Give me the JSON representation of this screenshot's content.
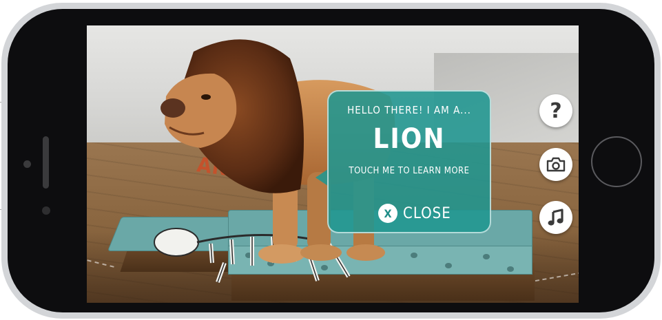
{
  "bubble": {
    "greeting": "HELLO THERE! I AM A...",
    "animal_name": "LION",
    "hint": "TOUCH ME TO LEARN MORE",
    "close_label": "CLOSE",
    "close_glyph": "X",
    "background": "#2a9a94"
  },
  "controls": {
    "help_glyph": "?",
    "buttons": [
      "help-icon",
      "camera-icon",
      "music-note-icon"
    ]
  },
  "scene": {
    "animal": "lion",
    "logo_text": "AR"
  }
}
